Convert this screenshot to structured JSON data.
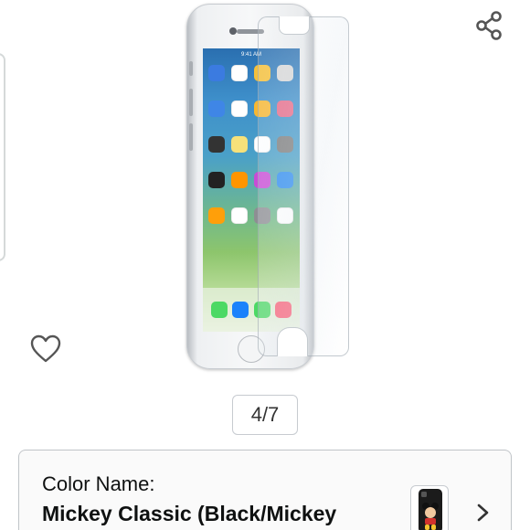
{
  "gallery": {
    "page_indicator": "4/7",
    "share_icon": "share-icon",
    "favorite_icon": "heart-outline-icon"
  },
  "product_image": {
    "status_time": "9:41 AM",
    "app_icon_colors": [
      "#3b7be0",
      "#ffffff",
      "#f5c03a",
      "#d8d8d8",
      "#3f86e6",
      "#ffffff",
      "#f7b731",
      "#e86a88",
      "#333333",
      "#f6e17a",
      "#ffffff",
      "#7c7c7c",
      "#222222",
      "#ff9500",
      "#c94bd6",
      "#2d8cf0",
      "#ff9f0a",
      "#ffffff",
      "#8e8e93",
      "#ffffff"
    ],
    "dock_icon_colors": [
      "#4cd964",
      "#1a82fb",
      "#4cd964",
      "#fb5c74"
    ]
  },
  "variant": {
    "label": "Color Name:",
    "value": "Mickey Classic (Black/Mickey",
    "chevron_icon": "chevron-right-icon"
  },
  "colors": {
    "border": "#c0c4c8",
    "text": "#0f1111",
    "icon": "#555555"
  }
}
